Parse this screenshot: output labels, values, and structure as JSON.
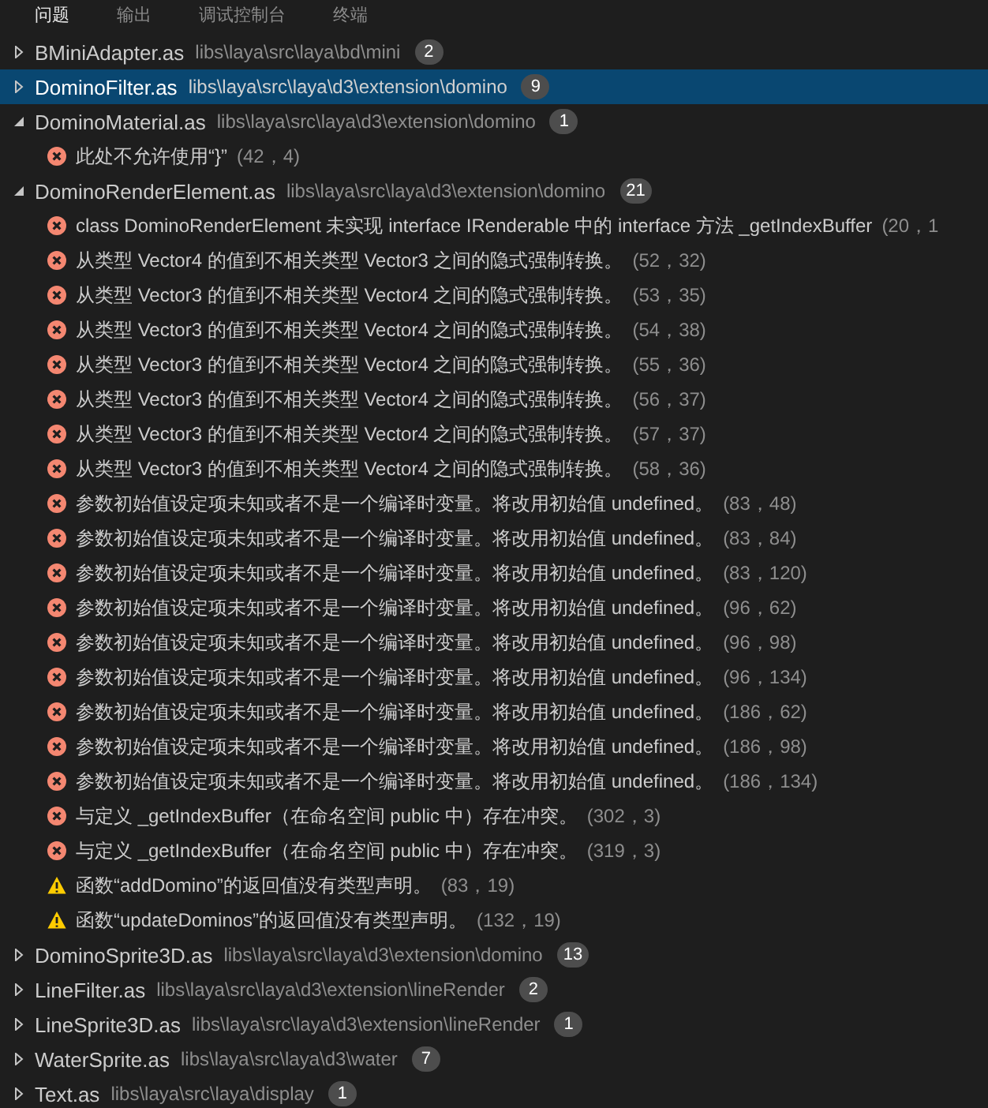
{
  "tabs": [
    {
      "label": "问题",
      "selected": true
    },
    {
      "label": "输出",
      "selected": false
    },
    {
      "label": "调试控制台",
      "selected": false
    },
    {
      "label": "终端",
      "selected": false
    }
  ],
  "files": [
    {
      "name": "BMiniAdapter.as",
      "path": "libs\\laya\\src\\laya\\bd\\mini",
      "count": "2",
      "expanded": false,
      "selected": false
    },
    {
      "name": "DominoFilter.as",
      "path": "libs\\laya\\src\\laya\\d3\\extension\\domino",
      "count": "9",
      "expanded": false,
      "selected": true
    },
    {
      "name": "DominoMaterial.as",
      "path": "libs\\laya\\src\\laya\\d3\\extension\\domino",
      "count": "1",
      "expanded": true,
      "selected": false,
      "children": [
        {
          "kind": "error",
          "message": "此处不允许使用“}”",
          "position": "(42，4)"
        }
      ]
    },
    {
      "name": "DominoRenderElement.as",
      "path": "libs\\laya\\src\\laya\\d3\\extension\\domino",
      "count": "21",
      "expanded": true,
      "selected": false,
      "children": [
        {
          "kind": "error",
          "message": "class DominoRenderElement 未实现 interface IRenderable 中的 interface 方法 _getIndexBuffer",
          "position": "(20，1"
        },
        {
          "kind": "error",
          "message": "从类型 Vector4 的值到不相关类型 Vector3 之间的隐式强制转换。",
          "position": "(52，32)"
        },
        {
          "kind": "error",
          "message": "从类型 Vector3 的值到不相关类型 Vector4 之间的隐式强制转换。",
          "position": "(53，35)"
        },
        {
          "kind": "error",
          "message": "从类型 Vector3 的值到不相关类型 Vector4 之间的隐式强制转换。",
          "position": "(54，38)"
        },
        {
          "kind": "error",
          "message": "从类型 Vector3 的值到不相关类型 Vector4 之间的隐式强制转换。",
          "position": "(55，36)"
        },
        {
          "kind": "error",
          "message": "从类型 Vector3 的值到不相关类型 Vector4 之间的隐式强制转换。",
          "position": "(56，37)"
        },
        {
          "kind": "error",
          "message": "从类型 Vector3 的值到不相关类型 Vector4 之间的隐式强制转换。",
          "position": "(57，37)"
        },
        {
          "kind": "error",
          "message": "从类型 Vector3 的值到不相关类型 Vector4 之间的隐式强制转换。",
          "position": "(58，36)"
        },
        {
          "kind": "error",
          "message": "参数初始值设定项未知或者不是一个编译时变量。将改用初始值 undefined。",
          "position": "(83，48)"
        },
        {
          "kind": "error",
          "message": "参数初始值设定项未知或者不是一个编译时变量。将改用初始值 undefined。",
          "position": "(83，84)"
        },
        {
          "kind": "error",
          "message": "参数初始值设定项未知或者不是一个编译时变量。将改用初始值 undefined。",
          "position": "(83，120)"
        },
        {
          "kind": "error",
          "message": "参数初始值设定项未知或者不是一个编译时变量。将改用初始值 undefined。",
          "position": "(96，62)"
        },
        {
          "kind": "error",
          "message": "参数初始值设定项未知或者不是一个编译时变量。将改用初始值 undefined。",
          "position": "(96，98)"
        },
        {
          "kind": "error",
          "message": "参数初始值设定项未知或者不是一个编译时变量。将改用初始值 undefined。",
          "position": "(96，134)"
        },
        {
          "kind": "error",
          "message": "参数初始值设定项未知或者不是一个编译时变量。将改用初始值 undefined。",
          "position": "(186，62)"
        },
        {
          "kind": "error",
          "message": "参数初始值设定项未知或者不是一个编译时变量。将改用初始值 undefined。",
          "position": "(186，98)"
        },
        {
          "kind": "error",
          "message": "参数初始值设定项未知或者不是一个编译时变量。将改用初始值 undefined。",
          "position": "(186，134)"
        },
        {
          "kind": "error",
          "message": "与定义 _getIndexBuffer（在命名空间 public 中）存在冲突。",
          "position": "(302，3)"
        },
        {
          "kind": "error",
          "message": "与定义 _getIndexBuffer（在命名空间 public 中）存在冲突。",
          "position": "(319，3)"
        },
        {
          "kind": "warning",
          "message": "函数“addDomino”的返回值没有类型声明。",
          "position": "(83，19)"
        },
        {
          "kind": "warning",
          "message": "函数“updateDominos”的返回值没有类型声明。",
          "position": "(132，19)"
        }
      ]
    },
    {
      "name": "DominoSprite3D.as",
      "path": "libs\\laya\\src\\laya\\d3\\extension\\domino",
      "count": "13",
      "expanded": false,
      "selected": false
    },
    {
      "name": "LineFilter.as",
      "path": "libs\\laya\\src\\laya\\d3\\extension\\lineRender",
      "count": "2",
      "expanded": false,
      "selected": false
    },
    {
      "name": "LineSprite3D.as",
      "path": "libs\\laya\\src\\laya\\d3\\extension\\lineRender",
      "count": "1",
      "expanded": false,
      "selected": false
    },
    {
      "name": "WaterSprite.as",
      "path": "libs\\laya\\src\\laya\\d3\\water",
      "count": "7",
      "expanded": false,
      "selected": false
    },
    {
      "name": "Text.as",
      "path": "libs\\laya\\src\\laya\\display",
      "count": "1",
      "expanded": false,
      "selected": false
    }
  ]
}
